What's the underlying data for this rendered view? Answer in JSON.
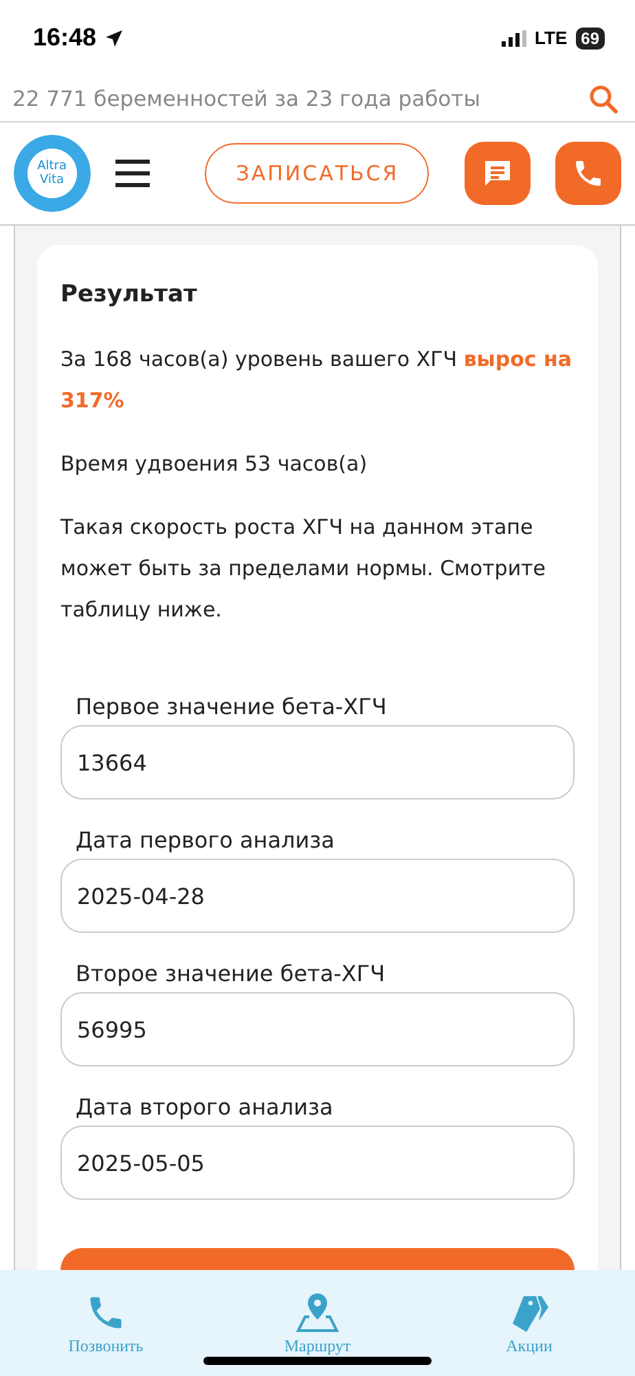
{
  "status_bar": {
    "time": "16:48",
    "network": "LTE",
    "battery": "69"
  },
  "tagline": "22 771 беременностей за 23 года работы",
  "header": {
    "logo": [
      "Altra",
      "Vita"
    ],
    "book_button": "ЗАПИСАТЬСЯ"
  },
  "result": {
    "title": "Результат",
    "summary": "За 168 часов(а) уровень вашего ХГЧ **вырос на 317%**",
    "doubling": "Время удвоения 53 часов(а)",
    "note": "Такая скорость роста ХГЧ на данном этапе может быть за пределами нормы. Смотрите таблицу ниже."
  },
  "fields": [
    {
      "label": "Первое значение бета-ХГЧ",
      "value": "13664"
    },
    {
      "label": "Дата первого анализа",
      "value": "2025-04-28"
    },
    {
      "label": "Второе значение бета-ХГЧ",
      "value": "56995"
    },
    {
      "label": "Дата второго анализа",
      "value": "2025-05-05"
    }
  ],
  "bottom_nav": [
    {
      "kind": "phone",
      "label": "Позвонить"
    },
    {
      "kind": "route",
      "label": "Маршрут"
    },
    {
      "kind": "tags",
      "label": "Акции"
    }
  ]
}
